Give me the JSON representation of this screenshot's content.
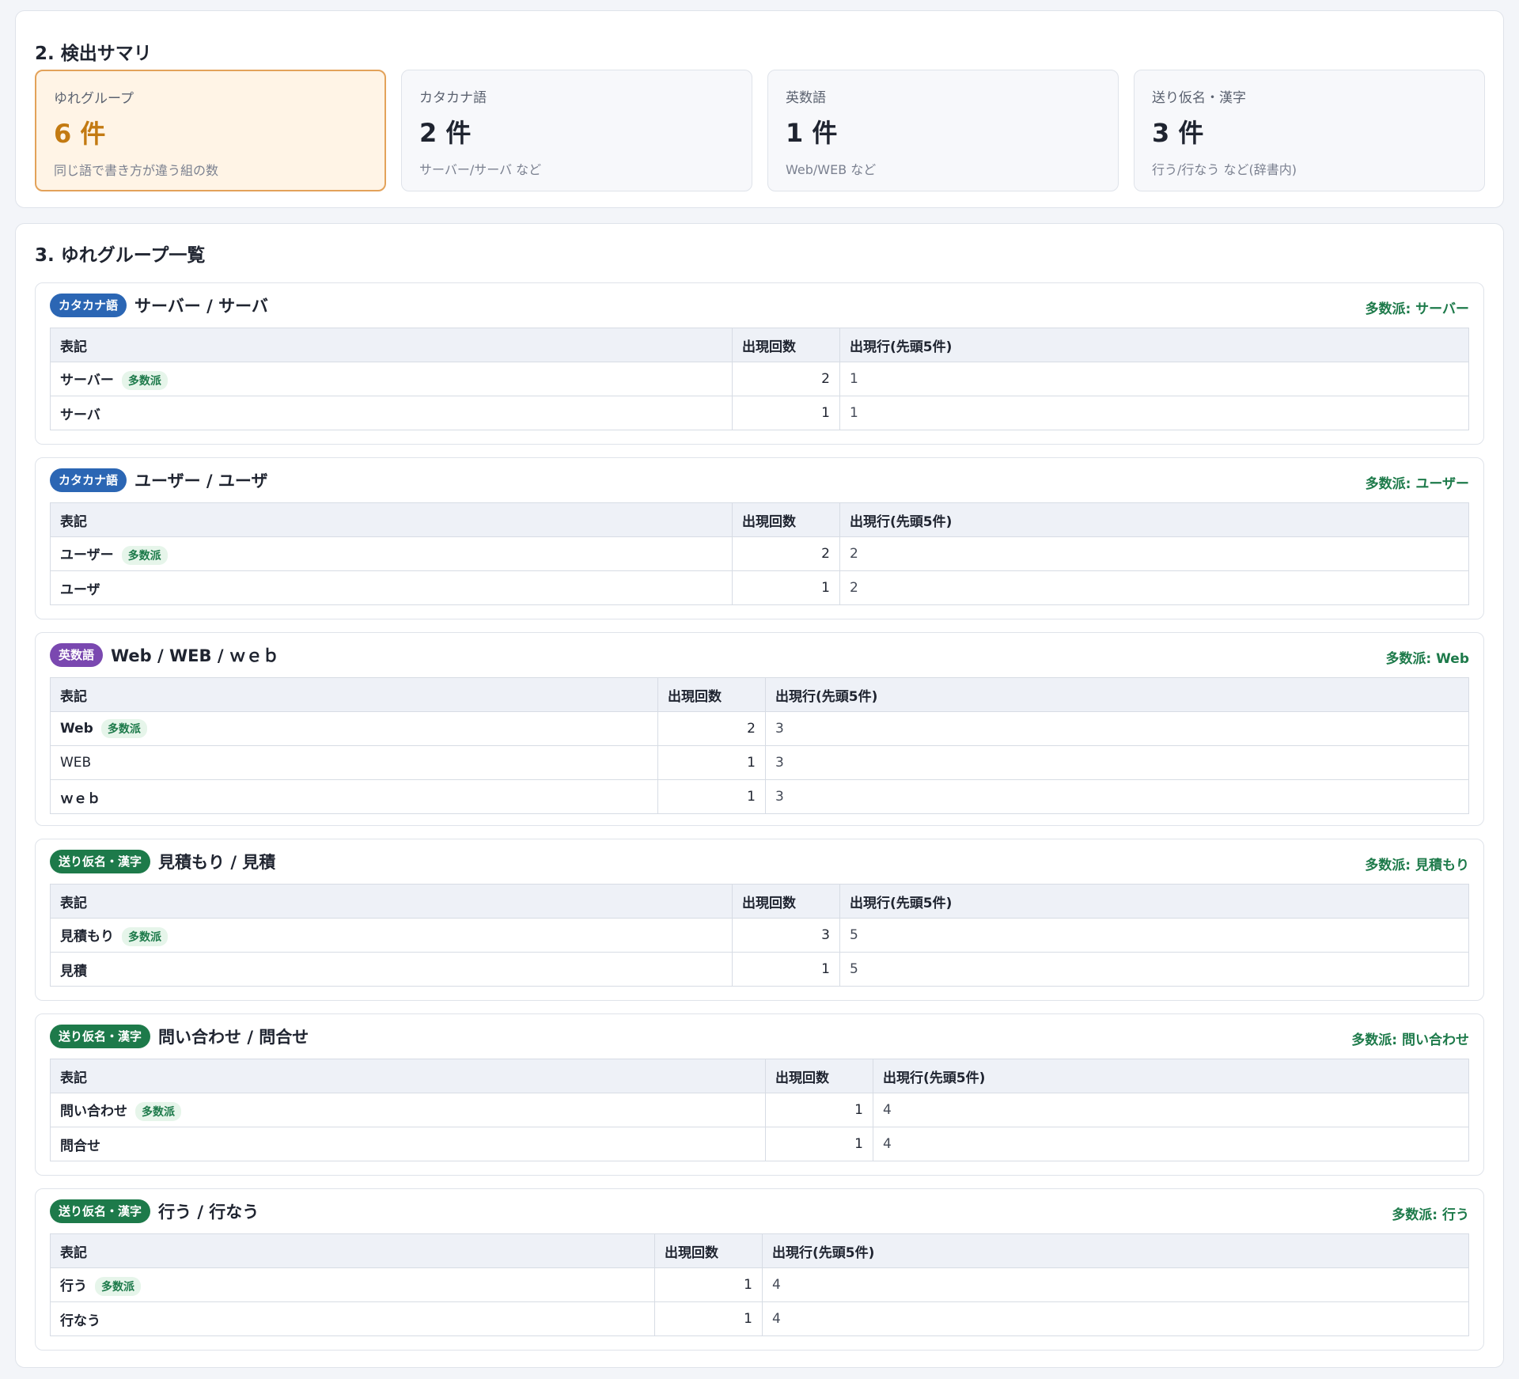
{
  "summary": {
    "title": "2. 検出サマリ",
    "cards": [
      {
        "label": "ゆれグループ",
        "value": "6 件",
        "note": "同じ語で書き方が違う組の数"
      },
      {
        "label": "カタカナ語",
        "value": "2 件",
        "note": "サーバー/サーバ など"
      },
      {
        "label": "英数語",
        "value": "1 件",
        "note": "Web/WEB など"
      },
      {
        "label": "送り仮名・漢字",
        "value": "3 件",
        "note": "行う/行なう など(辞書内)"
      }
    ]
  },
  "groups_section": {
    "title": "3. ゆれグループ一覧",
    "columns": {
      "term": "表記",
      "count": "出現回数",
      "lines": "出現行(先頭5件)"
    },
    "majority_tag": "多数派",
    "groups": [
      {
        "badge": "カタカナ語",
        "title": "サーバー / サーバ",
        "majority": "多数派: サーバー",
        "rows": [
          {
            "term": "サーバー",
            "count": "2",
            "lines": "1"
          },
          {
            "term": "サーバ",
            "count": "1",
            "lines": "1"
          }
        ]
      },
      {
        "badge": "カタカナ語",
        "title": "ユーザー / ユーザ",
        "majority": "多数派: ユーザー",
        "rows": [
          {
            "term": "ユーザー",
            "count": "2",
            "lines": "2"
          },
          {
            "term": "ユーザ",
            "count": "1",
            "lines": "2"
          }
        ]
      },
      {
        "badge": "英数語",
        "title": "Web / WEB / ｗｅｂ",
        "majority": "多数派: Web",
        "rows": [
          {
            "term": "Web",
            "count": "2",
            "lines": "3"
          },
          {
            "term": "WEB",
            "count": "1",
            "lines": "3"
          },
          {
            "term": "ｗｅｂ",
            "count": "1",
            "lines": "3"
          }
        ]
      },
      {
        "badge": "送り仮名・漢字",
        "title": "見積もり / 見積",
        "majority": "多数派: 見積もり",
        "rows": [
          {
            "term": "見積もり",
            "count": "3",
            "lines": "5"
          },
          {
            "term": "見積",
            "count": "1",
            "lines": "5"
          }
        ]
      },
      {
        "badge": "送り仮名・漢字",
        "title": "問い合わせ / 問合せ",
        "majority": "多数派: 問い合わせ",
        "rows": [
          {
            "term": "問い合わせ",
            "count": "1",
            "lines": "4"
          },
          {
            "term": "問合せ",
            "count": "1",
            "lines": "4"
          }
        ]
      },
      {
        "badge": "送り仮名・漢字",
        "title": "行う / 行なう",
        "majority": "多数派: 行う",
        "rows": [
          {
            "term": "行う",
            "count": "1",
            "lines": "4"
          },
          {
            "term": "行なう",
            "count": "1",
            "lines": "4"
          }
        ]
      }
    ]
  },
  "colors": {
    "badge_katakana": "#2b66b4",
    "badge_eisu": "#7a48b0",
    "badge_okurigana": "#1d7a4a",
    "highlight_value": "#c37a12"
  }
}
